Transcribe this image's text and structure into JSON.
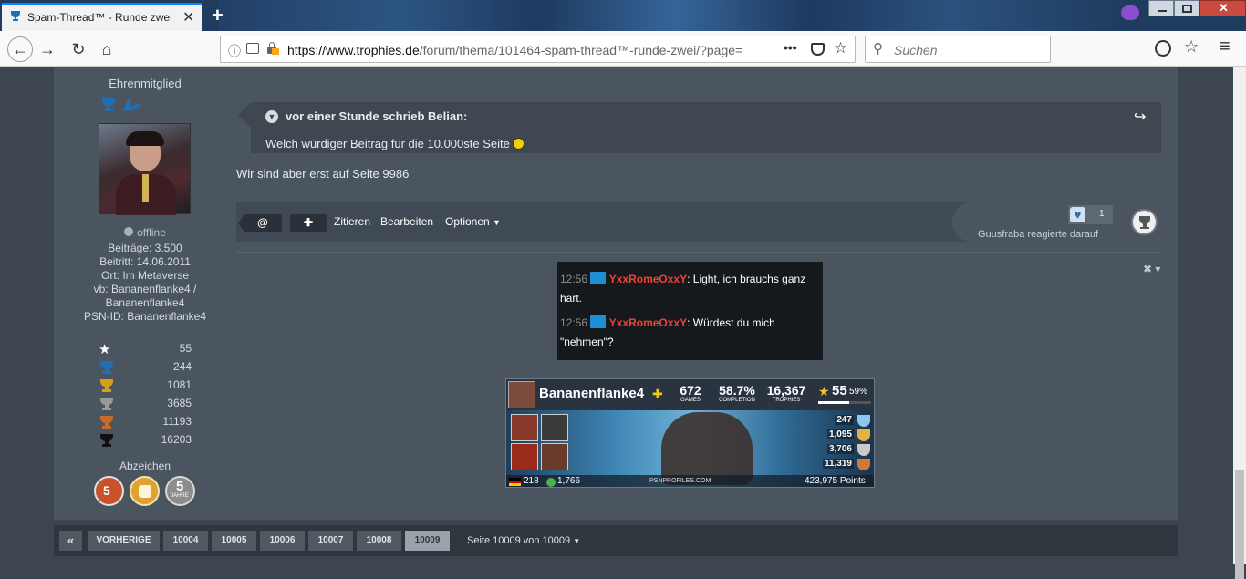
{
  "browser": {
    "tab_title": "Spam-Thread™ - Runde zwei -",
    "url_domain": "https://www.trophies.de",
    "url_path": "/forum/thema/101464-spam-thread™-runde-zwei/?page=",
    "search_placeholder": "Suchen",
    "new_tab_symbol": "+",
    "close_symbol": "✕"
  },
  "author": {
    "role": "Ehrenmitglied",
    "status": "offline",
    "posts": "Beiträge: 3.500",
    "joined": "Beitritt: 14.06.2011",
    "location": "Ort: Im Metaverse",
    "vb_line1": "vb: Bananenflanke4 /",
    "vb_line2": "Bananenflanke4",
    "psn": "PSN-ID: Bananenflanke4",
    "trophy_counts": [
      {
        "icon": "star-icon",
        "value": "55",
        "color": "#ffffff"
      },
      {
        "icon": "platinum-trophy-icon",
        "value": "244",
        "color": "#1f6fb2"
      },
      {
        "icon": "gold-trophy-icon",
        "value": "1081",
        "color": "#d4a017"
      },
      {
        "icon": "silver-trophy-icon",
        "value": "3685",
        "color": "#9a9a9a"
      },
      {
        "icon": "bronze-trophy-icon",
        "value": "11193",
        "color": "#c86a2c"
      },
      {
        "icon": "total-trophy-icon",
        "value": "16203",
        "color": "#111111"
      }
    ],
    "badges_title": "Abzeichen",
    "badge3_text": "5",
    "badge3_sub": "JAHRE"
  },
  "post": {
    "quote_header_prefix": "vor einer Stunde schrieb ",
    "quote_author": "Belian:",
    "quote_text": "Welch würdiger Beitrag für die 10.000ste Seite",
    "body": "Wir sind aber erst auf Seite 9986",
    "actions": {
      "mention": "@",
      "plus": "✚",
      "cite": "Zitieren",
      "edit": "Bearbeiten",
      "options": "Optionen"
    },
    "like_count": "1",
    "reacted": "Guusfraba reagierte darauf"
  },
  "chat": [
    {
      "time": "12:56",
      "user": "YxxRomeOxxY",
      "text_line1": ": Light, ich brauchs ganz",
      "text_line2": "hart."
    },
    {
      "time": "12:56",
      "user": "YxxRomeOxxY",
      "text_line1": ": Würdest du mich",
      "text_line2": "\"nehmen\"?"
    }
  ],
  "psn_banner": {
    "name": "Bananenflanke4",
    "games": "672",
    "games_label": "GAMES",
    "completion": "58.7%",
    "completion_label": "COMPLETION",
    "trophies": "16,367",
    "trophies_label": "TROPHIES",
    "level": "55",
    "level_pct": "59%",
    "counts": [
      "247",
      "1,095",
      "3,706",
      "11,319"
    ],
    "country_rank": "218",
    "world_rank": "1,766",
    "site": "—PSNPROFILES.COM—",
    "points": "423,975 Points"
  },
  "pagination": {
    "first": "«",
    "prev": "VORHERIGE",
    "pages": [
      "10004",
      "10005",
      "10006",
      "10007",
      "10008",
      "10009"
    ],
    "active": "10009",
    "summary": "Seite 10009 von 10009"
  },
  "colors": {
    "accent": "#0a84ff",
    "chat_user": "#e8443a",
    "page_bg": "#3d4650",
    "post_bg": "#4a5560"
  }
}
